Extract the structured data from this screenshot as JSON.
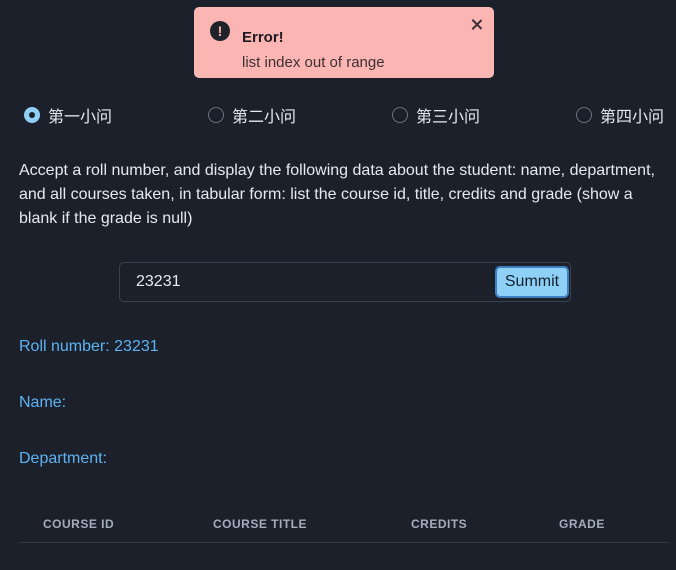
{
  "toast": {
    "title": "Error!",
    "message": "list index out of range",
    "icon": "alert-circle-icon",
    "background": "#fbb5b2"
  },
  "tabs": [
    {
      "label": "第一小问",
      "checked": true
    },
    {
      "label": "第二小问",
      "checked": false
    },
    {
      "label": "第三小问",
      "checked": false
    },
    {
      "label": "第四小问",
      "checked": false
    }
  ],
  "description": "Accept a roll number, and display the following data about the student: name, department, and all courses taken, in tabular form: list the course id, title, credits and grade (show a blank if the grade is null)",
  "input": {
    "value": "23231"
  },
  "submit_label": "Summit",
  "results": {
    "roll_number": "Roll number: 23231",
    "name": "Name:",
    "department": "Department:"
  },
  "table": {
    "columns": [
      "COURSE ID",
      "COURSE TITLE",
      "CREDITS",
      "GRADE"
    ],
    "rows": []
  },
  "colors": {
    "background": "#1b202b",
    "accent": "#8fd0f7",
    "info_text": "#5eb3f2"
  }
}
